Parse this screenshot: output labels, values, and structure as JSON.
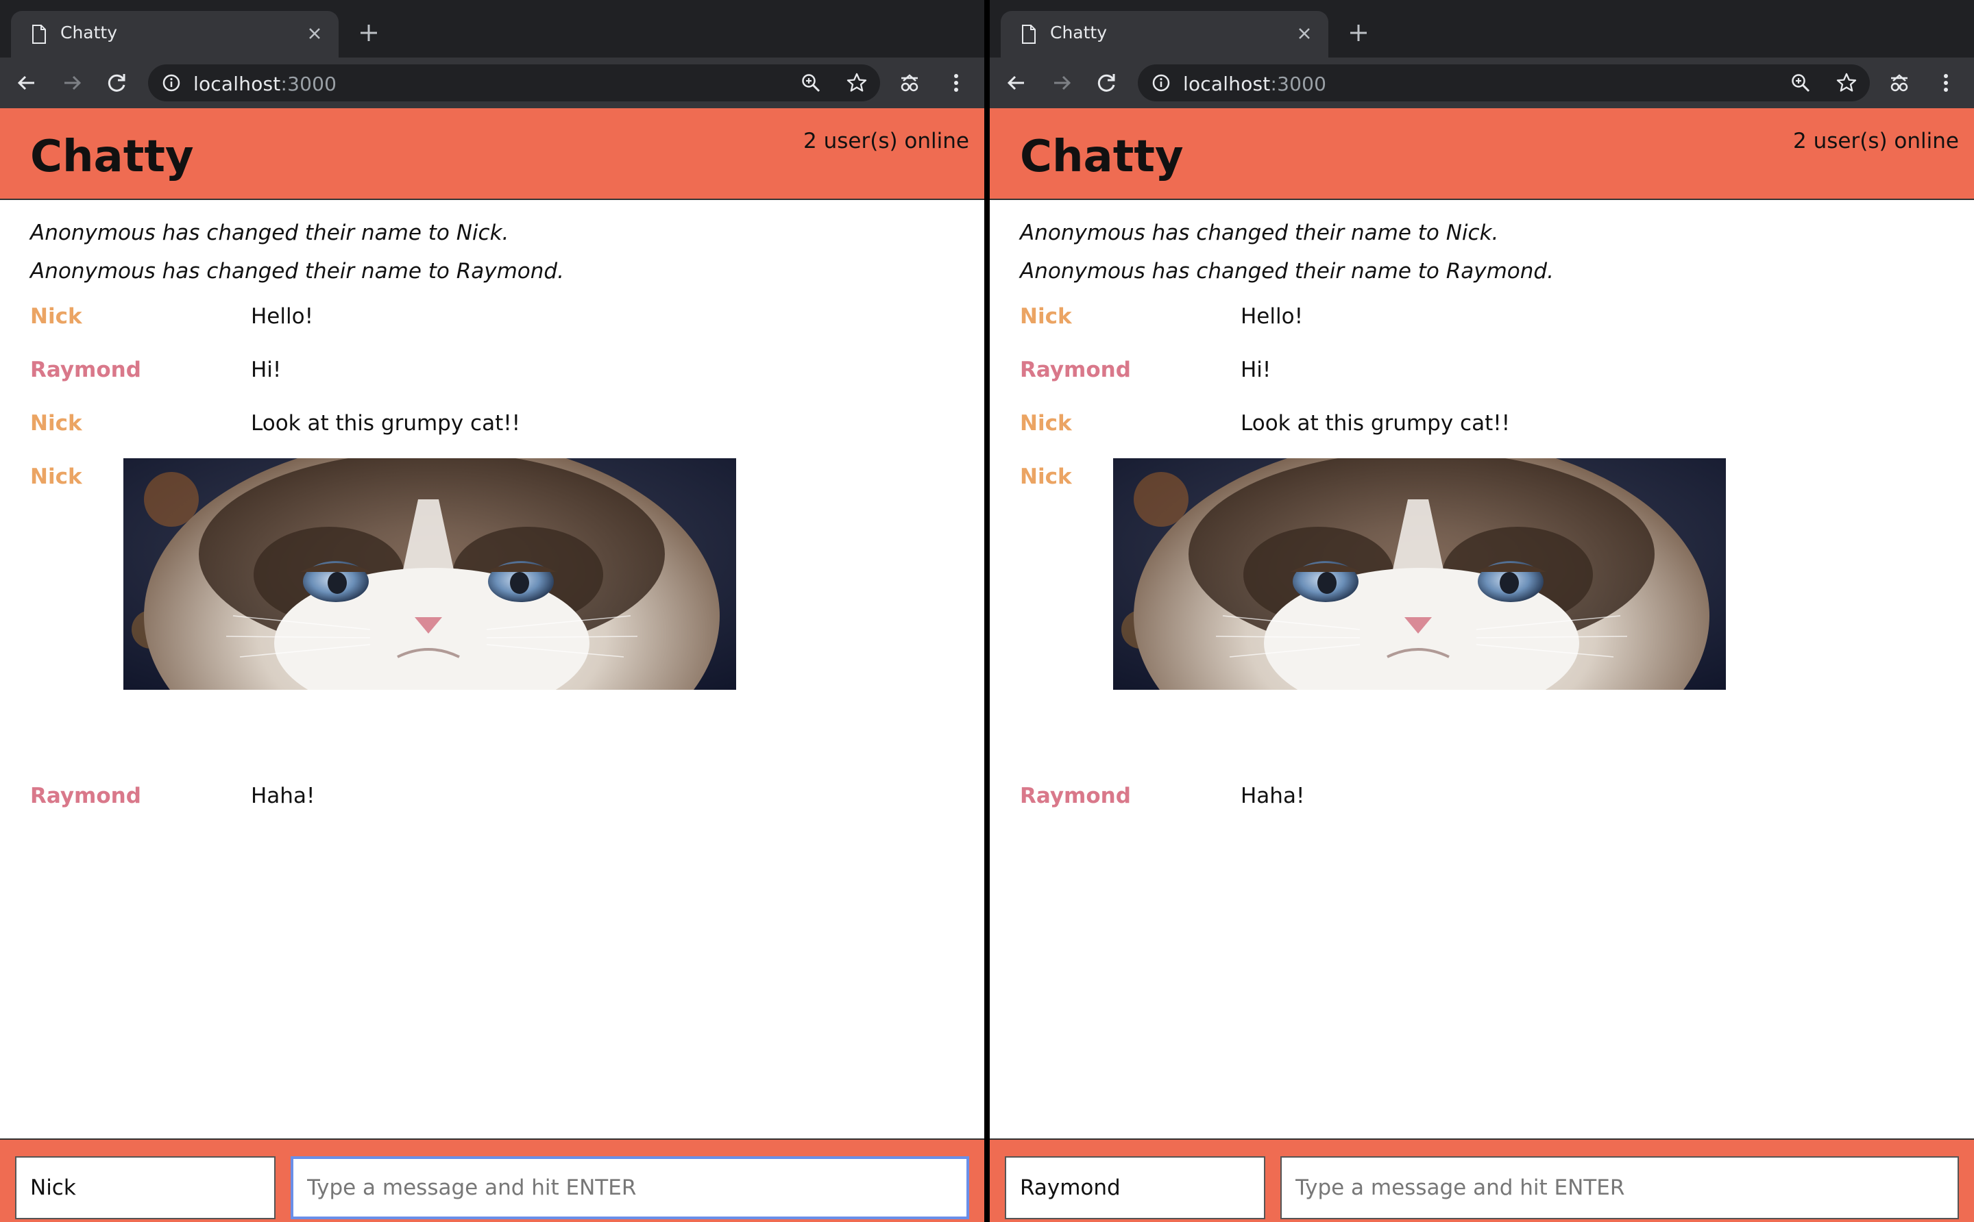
{
  "colors": {
    "header_bg": "#ef6c52",
    "chrome_dark": "#202124",
    "chrome_tab": "#35363a",
    "nick_color": "#eba463",
    "raymond_color": "#d9788a",
    "focus_ring": "#6a8fe8"
  },
  "windows": [
    {
      "tab": {
        "title": "Chatty",
        "icon": "document-icon",
        "close_icon": "close-icon"
      },
      "newtab_icon": "plus-icon",
      "toolbar": {
        "back_icon": "back-arrow-icon",
        "forward_icon": "forward-arrow-icon",
        "reload_icon": "reload-icon",
        "url_host": "localhost",
        "url_port": ":3000",
        "zoom_icon": "zoom-in-icon",
        "bookmark_icon": "star-icon",
        "extension_icon": "extension-icon",
        "menu_icon": "kebab-menu-icon"
      },
      "app": {
        "title": "Chatty",
        "online": "2 user(s) online",
        "notifications": [
          "Anonymous has changed their name to Nick.",
          "Anonymous has changed their name to Raymond."
        ],
        "messages": [
          {
            "user": "Nick",
            "text": "Hello!"
          },
          {
            "user": "Raymond",
            "text": "Hi!"
          },
          {
            "user": "Nick",
            "text": "Look at this grumpy cat!!"
          },
          {
            "user": "Nick",
            "image": "grumpy-cat-photo"
          },
          {
            "user": "Raymond",
            "text": "Haha!"
          }
        ],
        "footer": {
          "username_value": "Nick",
          "message_placeholder": "Type a message and hit ENTER",
          "message_focused": true
        }
      }
    },
    {
      "tab": {
        "title": "Chatty",
        "icon": "document-icon",
        "close_icon": "close-icon"
      },
      "newtab_icon": "plus-icon",
      "toolbar": {
        "back_icon": "back-arrow-icon",
        "forward_icon": "forward-arrow-icon",
        "reload_icon": "reload-icon",
        "url_host": "localhost",
        "url_port": ":3000",
        "zoom_icon": "zoom-in-icon",
        "bookmark_icon": "star-icon",
        "extension_icon": "extension-icon",
        "menu_icon": "kebab-menu-icon"
      },
      "app": {
        "title": "Chatty",
        "online": "2 user(s) online",
        "notifications": [
          "Anonymous has changed their name to Nick.",
          "Anonymous has changed their name to Raymond."
        ],
        "messages": [
          {
            "user": "Nick",
            "text": "Hello!"
          },
          {
            "user": "Raymond",
            "text": "Hi!"
          },
          {
            "user": "Nick",
            "text": "Look at this grumpy cat!!"
          },
          {
            "user": "Nick",
            "image": "grumpy-cat-photo"
          },
          {
            "user": "Raymond",
            "text": "Haha!"
          }
        ],
        "footer": {
          "username_value": "Raymond",
          "message_placeholder": "Type a message and hit ENTER",
          "message_focused": false
        }
      }
    }
  ]
}
